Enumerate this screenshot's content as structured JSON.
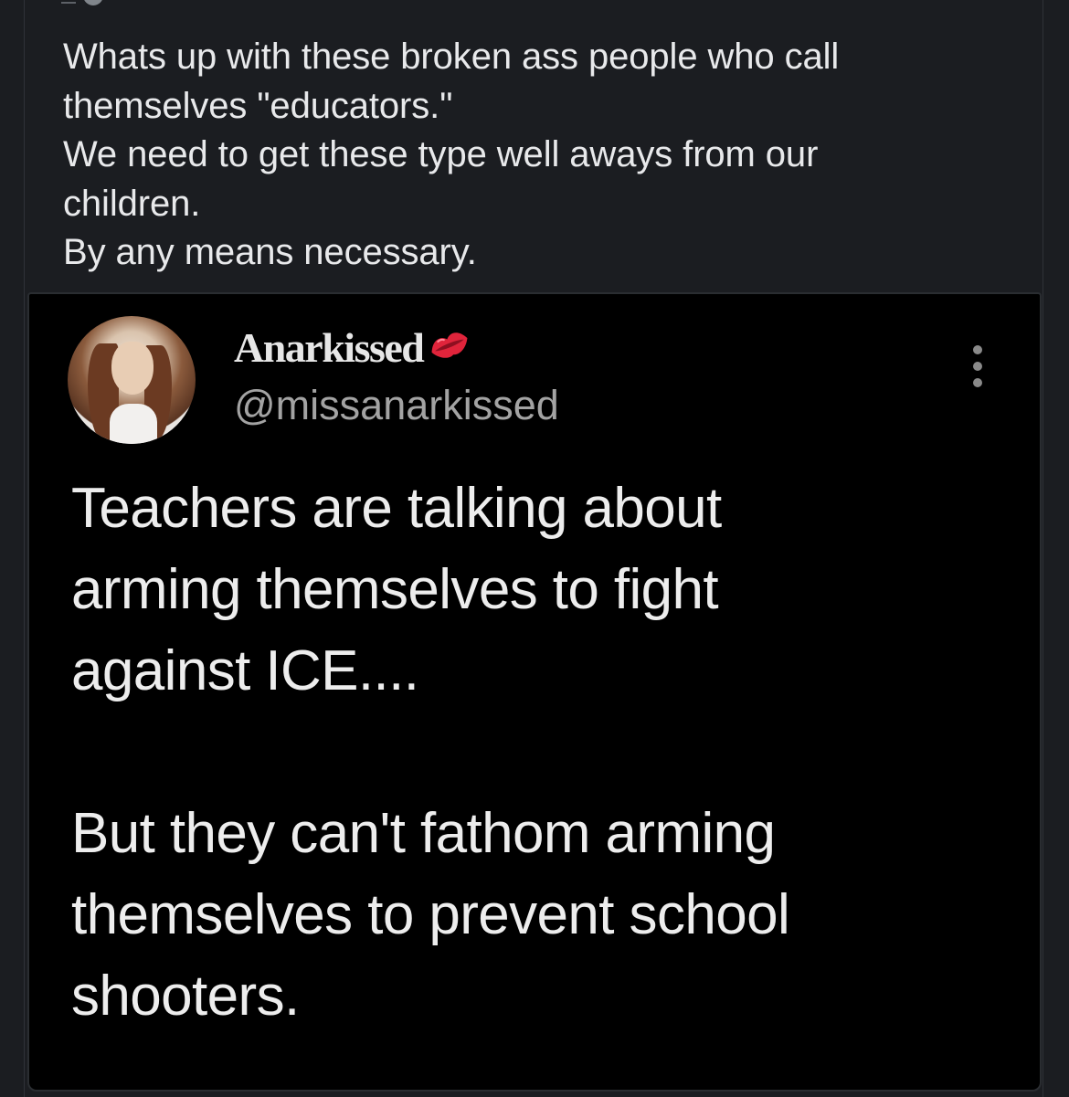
{
  "post": {
    "lines": [
      "Whats up with these broken ass people who call",
      "themselves \"educators.\"",
      "We need to get these type well aways from our",
      "children.",
      "By any means necessary."
    ]
  },
  "quoted_tweet": {
    "display_name": "Anarkissed",
    "name_emoji": "kiss-mark-icon",
    "handle": "@missanarkissed",
    "body_lines": [
      "Teachers are talking about",
      "arming themselves to fight",
      "against ICE....",
      "",
      "But they can't fathom arming",
      "themselves to prevent school",
      "shooters."
    ]
  },
  "colors": {
    "page_background": "#1b1d21",
    "post_text": "#e8e9eb",
    "quoted_background": "#000000",
    "kiss_red": "#e0243b"
  }
}
